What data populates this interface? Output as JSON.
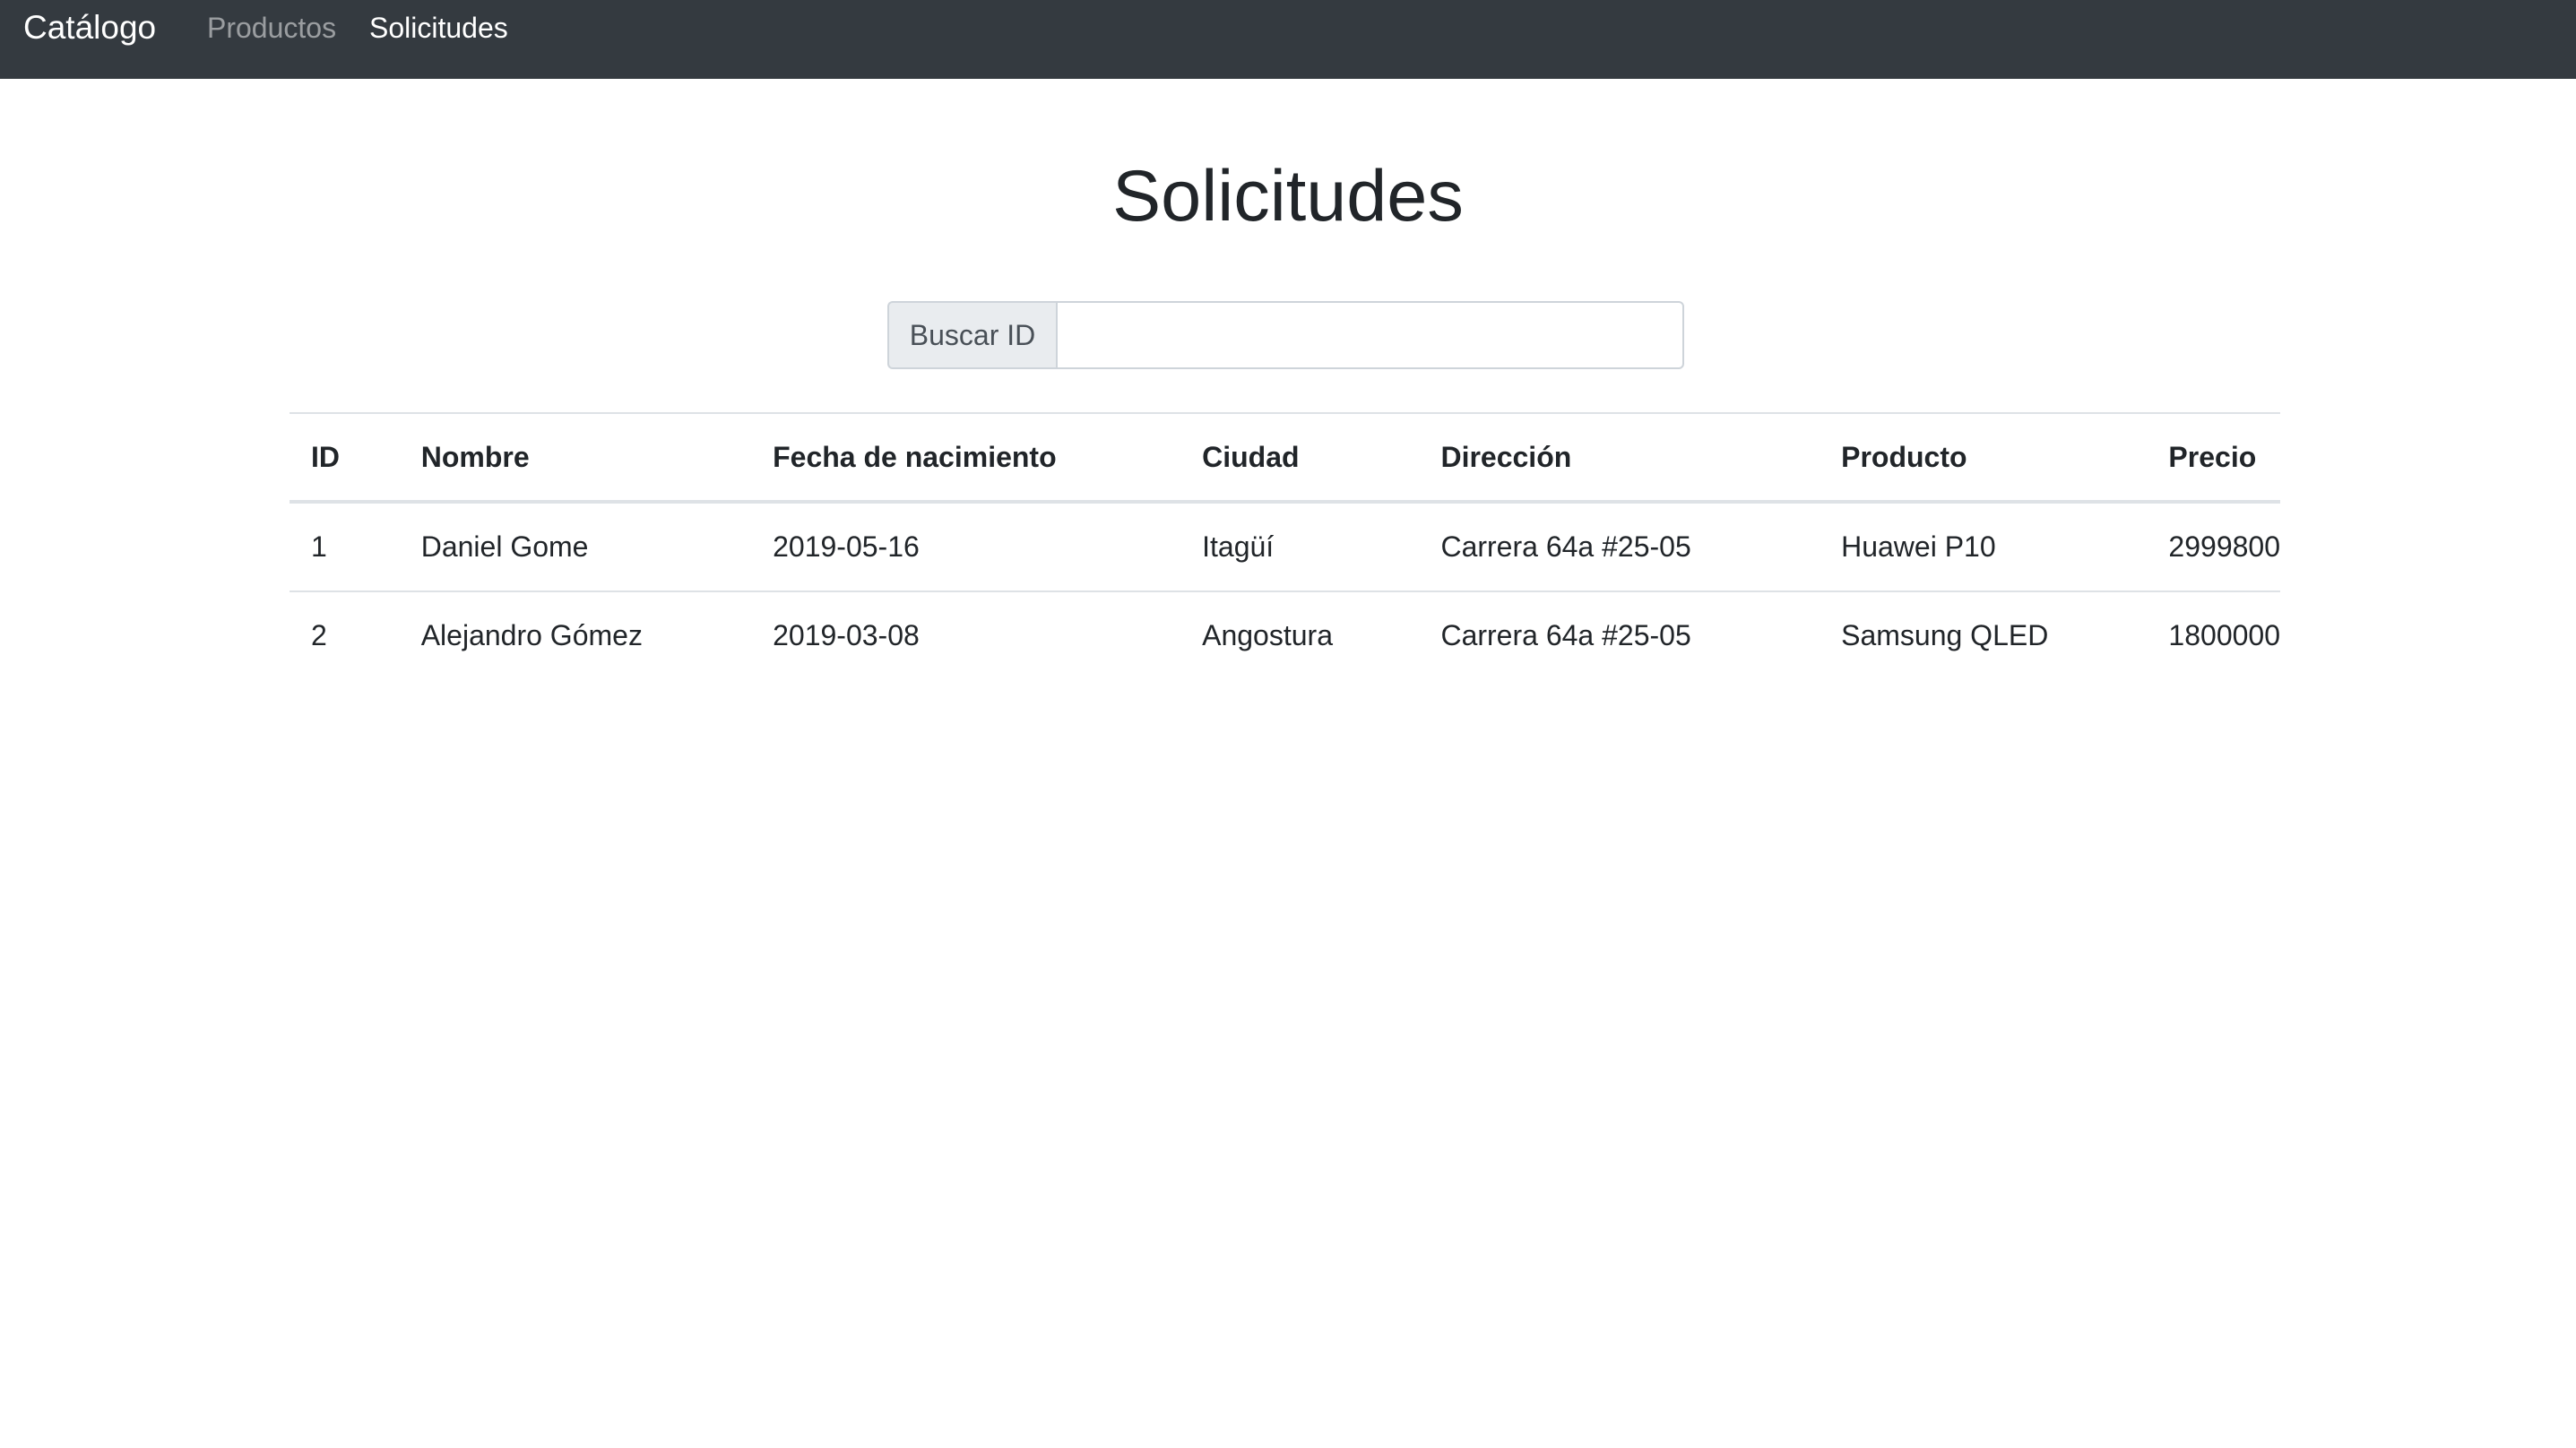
{
  "navbar": {
    "brand": "Catálogo",
    "links": [
      {
        "label": "Productos",
        "active": false
      },
      {
        "label": "Solicitudes",
        "active": true
      }
    ]
  },
  "page": {
    "title": "Solicitudes"
  },
  "search": {
    "label": "Buscar ID",
    "value": "",
    "placeholder": ""
  },
  "table": {
    "headers": [
      "ID",
      "Nombre",
      "Fecha de nacimiento",
      "Ciudad",
      "Dirección",
      "Producto",
      "Precio"
    ],
    "rows": [
      [
        "1",
        "Daniel Gome",
        "2019-05-16",
        "Itagüí",
        "Carrera 64a #25-05",
        "Huawei P10",
        "2999800"
      ],
      [
        "2",
        "Alejandro Gómez",
        "2019-03-08",
        "Angostura",
        "Carrera 64a #25-05",
        "Samsung QLED",
        "1800000"
      ]
    ]
  },
  "colors": {
    "navbar_bg": "#343a40",
    "text": "#212529",
    "border": "#dee2e6",
    "addon_bg": "#e9ecef"
  }
}
